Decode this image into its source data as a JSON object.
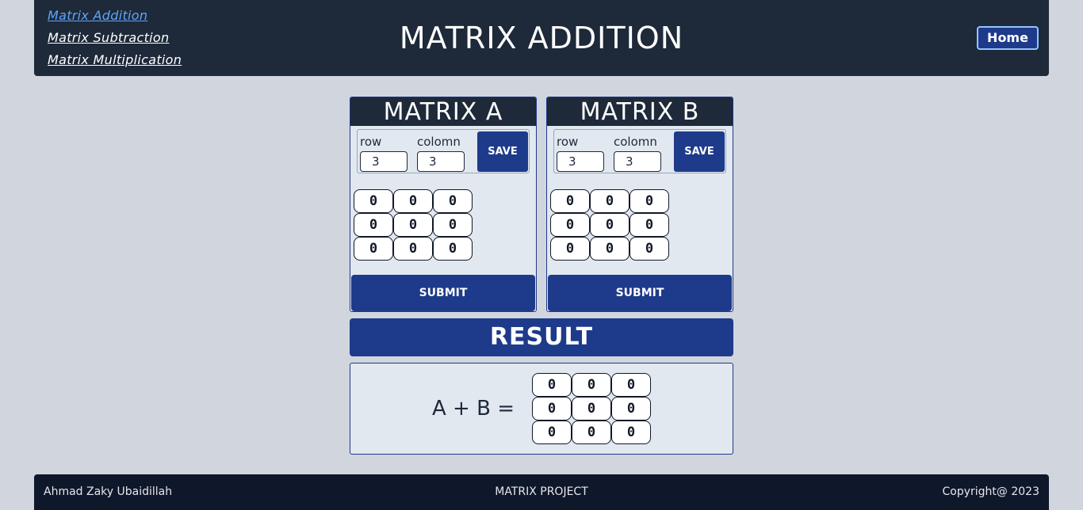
{
  "header": {
    "nav": [
      "Matrix Addition",
      "Matrix Subtraction",
      "Matrix Multiplication"
    ],
    "title": "MATRIX ADDITION",
    "home_label": "Home"
  },
  "matrix_a": {
    "title": "MATRIX A",
    "row_label": "row",
    "column_label": "colomn",
    "row_value": "3",
    "column_value": "3",
    "save_label": "SAVE",
    "cells": [
      "0",
      "0",
      "0",
      "0",
      "0",
      "0",
      "0",
      "0",
      "0"
    ],
    "submit_label": "SUBMIT"
  },
  "matrix_b": {
    "title": "MATRIX B",
    "row_label": "row",
    "column_label": "colomn",
    "row_value": "3",
    "column_value": "3",
    "save_label": "SAVE",
    "cells": [
      "0",
      "0",
      "0",
      "0",
      "0",
      "0",
      "0",
      "0",
      "0"
    ],
    "submit_label": "SUBMIT"
  },
  "result": {
    "title": "RESULT",
    "equation": "A + B =",
    "cells": [
      "0",
      "0",
      "0",
      "0",
      "0",
      "0",
      "0",
      "0",
      "0"
    ]
  },
  "footer": {
    "author": "Ahmad Zaky Ubaidillah",
    "project": "MATRIX PROJECT",
    "copyright": "Copyright@ 2023"
  }
}
